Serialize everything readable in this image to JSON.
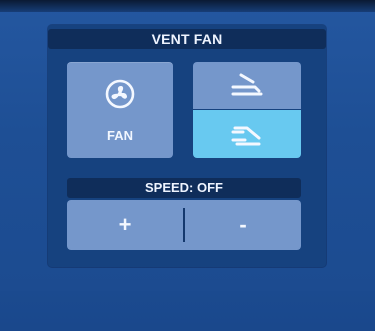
{
  "panel": {
    "title": "VENT FAN"
  },
  "fan_button": {
    "label": "FAN",
    "icon": "fan-icon"
  },
  "recirculation": {
    "top_icon": "fresh-air-icon",
    "bottom_icon": "recirculate-air-icon",
    "active": "bottom"
  },
  "speed": {
    "label": "SPEED: OFF",
    "plus_label": "+",
    "minus_label": "-"
  },
  "colors": {
    "background": "#1f5296",
    "panel": "#16427f",
    "header": "#0f2d5a",
    "button": "#7597cb",
    "active_button": "#68c9f0",
    "text": "#eef4ff"
  }
}
